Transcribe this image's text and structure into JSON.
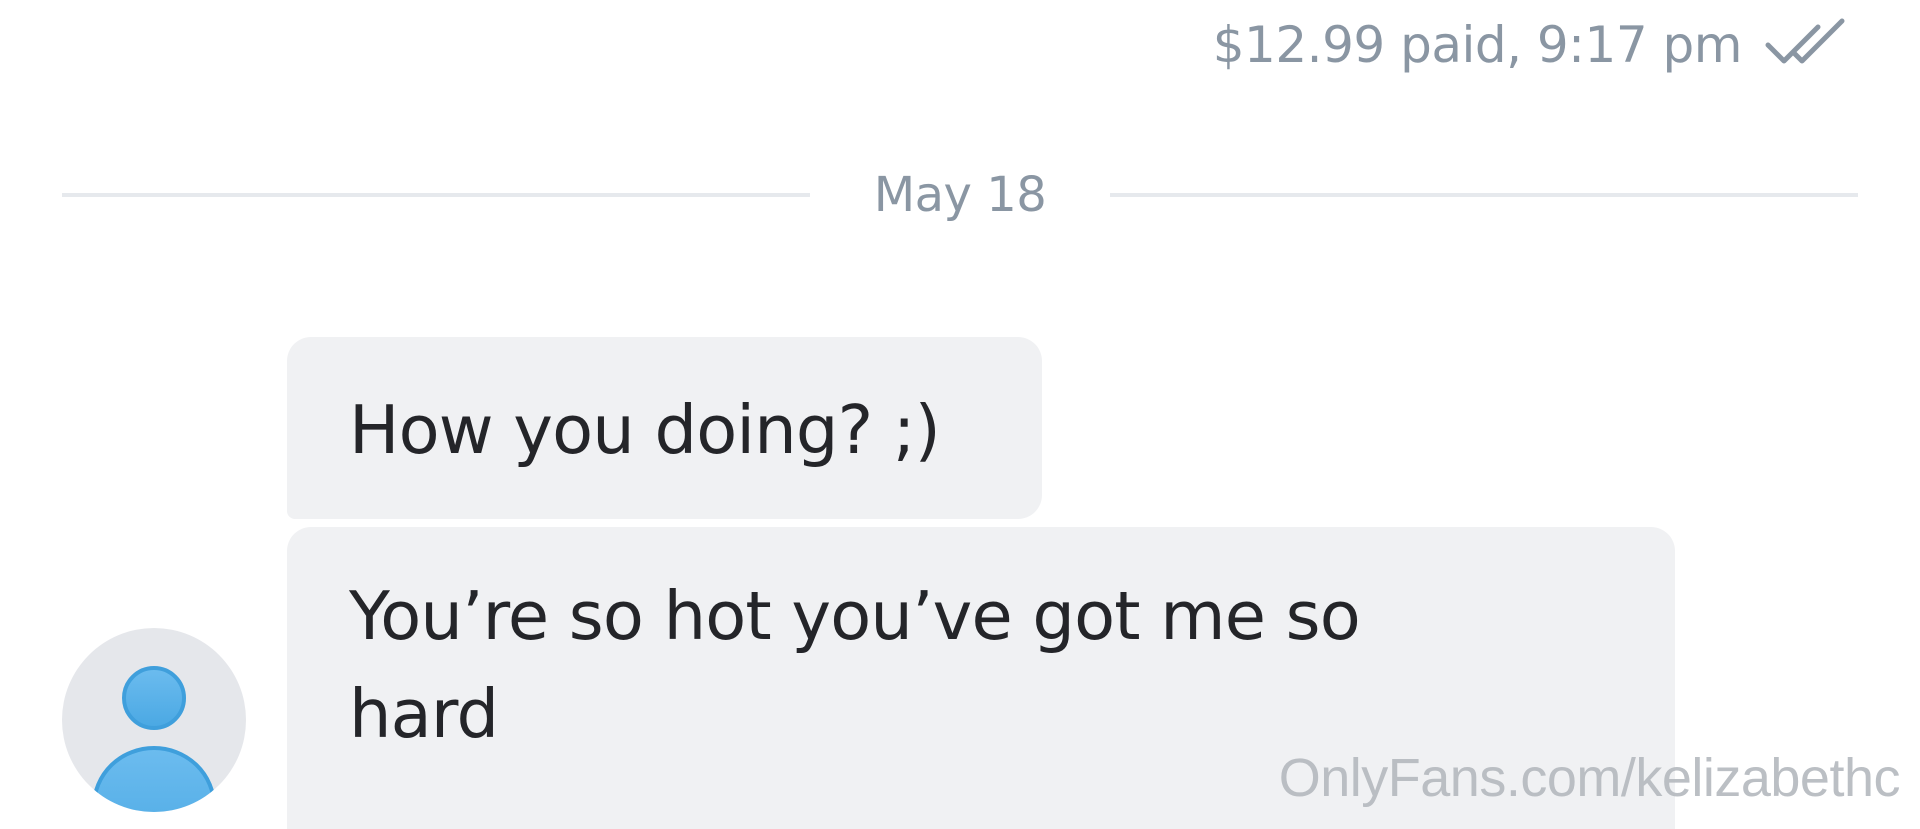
{
  "paid_message": {
    "status_text": "$12.99 paid, 9:17 pm",
    "status_icon": "double-check-icon",
    "meta_color": "#8a96a3"
  },
  "divider": {
    "date_label": "May 18"
  },
  "messages": [
    {
      "text": "How you doing? ;)"
    },
    {
      "text": "You’re so hot you’ve got me so hard"
    }
  ],
  "avatar": {
    "icon": "user-placeholder-icon",
    "accent": "#5db4ea"
  },
  "watermark": {
    "text": "OnlyFans.com/kelizabethc"
  },
  "colors": {
    "bubble_bg": "#f0f1f3",
    "text": "#242529",
    "muted": "#8a96a3"
  }
}
